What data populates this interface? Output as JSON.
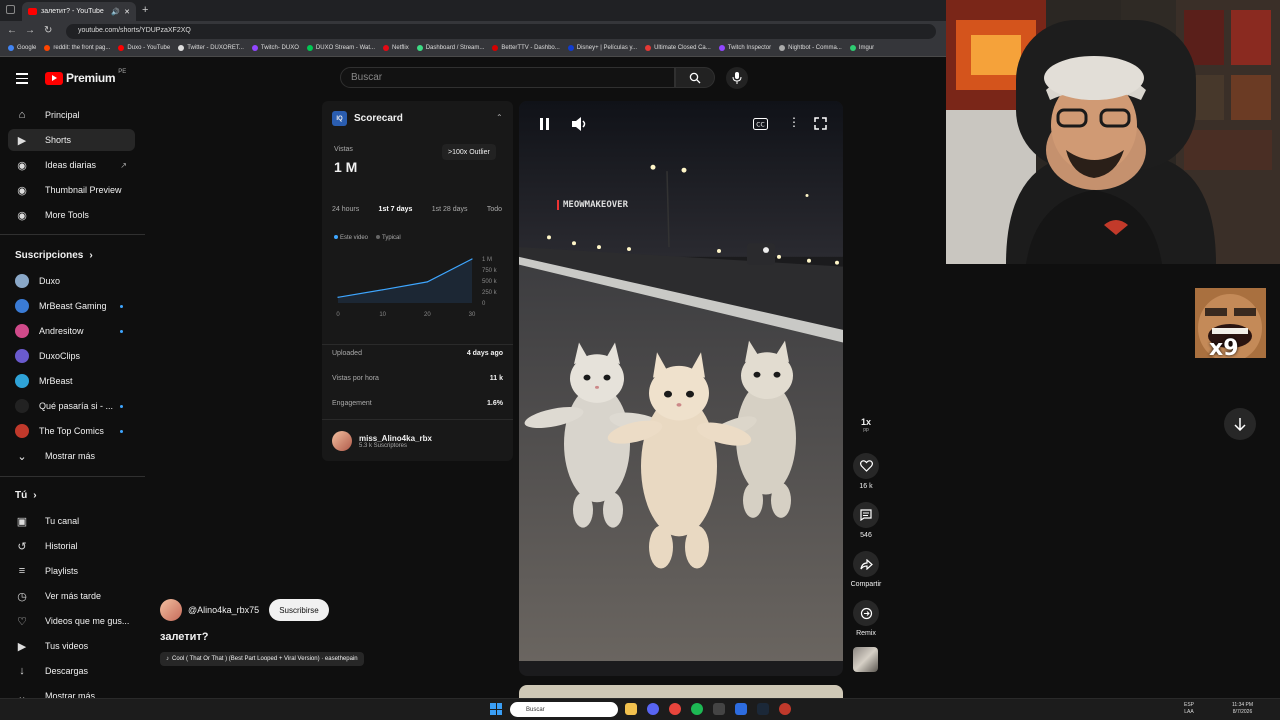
{
  "browser": {
    "tab_title": "залетит? - YouTube",
    "url": "youtube.com/shorts/YDUPzaXF2XQ",
    "bookmarks": [
      "Google",
      "reddit: the front pag...",
      "Duxo - YouTube",
      "Twitter - DUXORET...",
      "Twitch- DUXO",
      "DUXO Stream - Wat...",
      "Netflix",
      "Dashboard / Stream...",
      "BetterTTV - Dashbo...",
      "Disney+ | Películas y...",
      "Ultimate Closed Ca...",
      "Twitch Inspector",
      "Nightbot - Comma...",
      "Imgur"
    ]
  },
  "header": {
    "logo": "Premium",
    "region": "PE",
    "search_placeholder": "Buscar"
  },
  "sidebar": {
    "nav": [
      {
        "label": "Principal",
        "icon": "home-icon"
      },
      {
        "label": "Shorts",
        "icon": "shorts-icon"
      },
      {
        "label": "Ideas diarias",
        "icon": "bulb-icon"
      },
      {
        "label": "Thumbnail Preview",
        "icon": "thumbnail-icon"
      },
      {
        "label": "More Tools",
        "icon": "tools-icon"
      }
    ],
    "subs_title": "Suscripciones",
    "subs": [
      {
        "label": "Duxo",
        "color": "#8aa8c8",
        "dot": false
      },
      {
        "label": "MrBeast Gaming",
        "color": "#3a7bd5",
        "dot": true
      },
      {
        "label": "Andresitow",
        "color": "#d04a8a",
        "dot": true
      },
      {
        "label": "DuxoClips",
        "color": "#6a5acd",
        "dot": false
      },
      {
        "label": "MrBeast",
        "color": "#2fa3d8",
        "dot": false
      },
      {
        "label": "Qué pasaría si - ...",
        "color": "#222",
        "dot": true
      },
      {
        "label": "The Top Comics",
        "color": "#c0392b",
        "dot": true
      }
    ],
    "show_more": "Mostrar más",
    "you_title": "Tú",
    "you": [
      {
        "label": "Tu canal",
        "icon": "channel-icon"
      },
      {
        "label": "Historial",
        "icon": "history-icon"
      },
      {
        "label": "Playlists",
        "icon": "playlist-icon"
      },
      {
        "label": "Ver más tarde",
        "icon": "clock-icon"
      },
      {
        "label": "Videos que me gus...",
        "icon": "like-icon"
      },
      {
        "label": "Tus videos",
        "icon": "video-icon"
      },
      {
        "label": "Descargas",
        "icon": "download-icon"
      },
      {
        "label": "Mostrar más",
        "icon": "chevron-down-icon"
      }
    ]
  },
  "scorecard": {
    "title": "Scorecard",
    "iq": "IQ",
    "views_label": "Vistas",
    "views": "1 M",
    "outlier": ">100x Outlier",
    "periods": [
      "24 hours",
      "1st 7 days",
      "1st 28 days",
      "Todo"
    ],
    "legend_this": "Este video",
    "legend_typical": "Typical",
    "uploaded_label": "Uploaded",
    "uploaded": "4 days ago",
    "vph_label": "Vistas por hora",
    "vph": "11 k",
    "eng_label": "Engagement",
    "eng": "1.6%",
    "channel": "miss_Alino4ka_rbx",
    "subs": "5.3 k Suscriptores",
    "chart_data": {
      "type": "line",
      "x": [
        0,
        10,
        20,
        30
      ],
      "values": [
        0.13,
        0.3,
        0.48,
        1.0
      ],
      "xticks": [
        "0",
        "10",
        "20",
        "30"
      ],
      "yticks": [
        "1 M",
        "750 k",
        "500 k",
        "250 k",
        "0"
      ],
      "ylim": [
        0,
        1
      ],
      "xlim": [
        0,
        30
      ]
    }
  },
  "video": {
    "watermark": "MEOWMAKEOVER",
    "speed": "1x",
    "speed_sub": "pp",
    "likes": "16 k",
    "comments": "546",
    "share": "Compartir",
    "remix": "Remix",
    "channel": "@Alino4ka_rbx75",
    "subscribe": "Suscribirse",
    "title": "залетит?",
    "music": "Cool ( That Or That ) (Best Part Looped + Viral Version) · easethepain"
  },
  "overlay": {
    "x9": "x9"
  },
  "taskbar": {
    "search": "Buscar",
    "lang": "ESP",
    "lang2": "LAA",
    "time": "11:34 PM",
    "date": "8/7/2026"
  }
}
